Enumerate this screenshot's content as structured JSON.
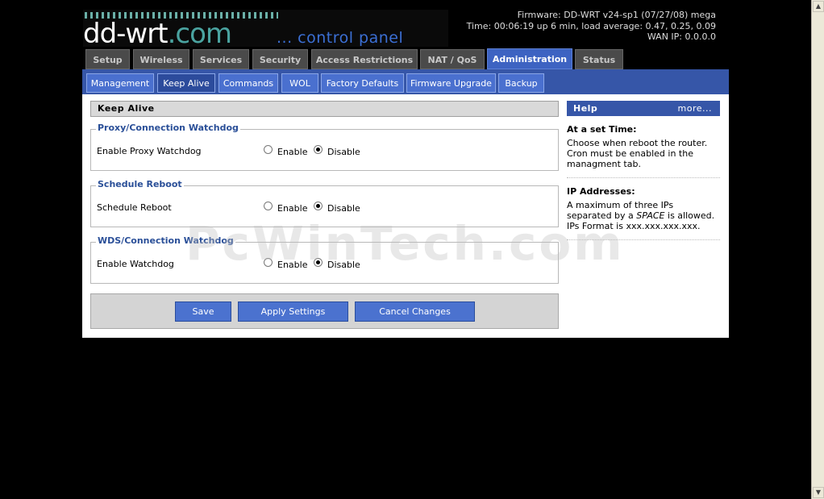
{
  "header": {
    "logo_text": "dd-wrt",
    "logo_suffix": ".com",
    "logo_tagline": "... control panel",
    "firmware": "Firmware: DD-WRT v24-sp1 (07/27/08) mega",
    "time": "Time: 00:06:19 up 6 min, load average: 0.47, 0.25, 0.09",
    "wan_ip": "WAN IP: 0.0.0.0"
  },
  "main_tabs": [
    "Setup",
    "Wireless",
    "Services",
    "Security",
    "Access Restrictions",
    "NAT / QoS",
    "Administration",
    "Status"
  ],
  "main_tab_active": "Administration",
  "sub_tabs": [
    "Management",
    "Keep Alive",
    "Commands",
    "WOL",
    "Factory Defaults",
    "Firmware Upgrade",
    "Backup"
  ],
  "sub_tab_active": "Keep Alive",
  "section_title": "Keep Alive",
  "groups": [
    {
      "legend": "Proxy/Connection Watchdog",
      "label": "Enable Proxy Watchdog",
      "enable": "Enable",
      "disable": "Disable",
      "selected": "Disable"
    },
    {
      "legend": "Schedule Reboot",
      "label": "Schedule Reboot",
      "enable": "Enable",
      "disable": "Disable",
      "selected": "Disable"
    },
    {
      "legend": "WDS/Connection Watchdog",
      "label": "Enable Watchdog",
      "enable": "Enable",
      "disable": "Disable",
      "selected": "Disable"
    }
  ],
  "buttons": {
    "save": "Save",
    "apply": "Apply Settings",
    "cancel": "Cancel Changes"
  },
  "help": {
    "title": "Help",
    "more": "more...",
    "sections": [
      {
        "heading": "At a set Time:",
        "text": "Choose when reboot the router. Cron must be enabled in the managment tab."
      },
      {
        "heading": "IP Addresses:",
        "text_pre": "A maximum of three IPs separated by a ",
        "text_em": "SPACE",
        "text_post": " is allowed.",
        "text2": "IPs Format is xxx.xxx.xxx.xxx."
      }
    ]
  },
  "watermark": "PcWinTech.com",
  "colors": {
    "accent": "#3656a8",
    "tab_active": "#3d63c2",
    "legend": "#2a4f98"
  }
}
